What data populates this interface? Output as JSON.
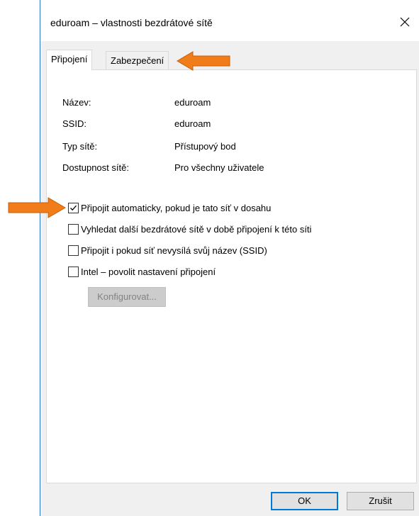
{
  "window": {
    "title": "eduroam – vlastnosti bezdrátové sítě"
  },
  "tabs": [
    {
      "label": "Připojení"
    },
    {
      "label": "Zabezpečení"
    }
  ],
  "properties": [
    {
      "label": "Název:",
      "value": "eduroam"
    },
    {
      "label": "SSID:",
      "value": "eduroam"
    },
    {
      "label": "Typ sítě:",
      "value": "Přístupový bod"
    },
    {
      "label": "Dostupnost sítě:",
      "value": "Pro všechny uživatele"
    }
  ],
  "options": [
    {
      "label": "Připojit automaticky, pokud je tato síť v dosahu",
      "checked": true
    },
    {
      "label": "Vyhledat další bezdrátové sítě v době připojení k této síti",
      "checked": false
    },
    {
      "label": "Připojit i pokud síť nevysílá svůj název (SSID)",
      "checked": false
    },
    {
      "label": "Intel – povolit nastavení připojení",
      "checked": false
    }
  ],
  "buttons": {
    "configure": "Konfigurovat...",
    "ok": "OK",
    "cancel": "Zrušit"
  },
  "colors": {
    "annotation_arrow": "#f07d1a",
    "window_border": "#2a78c7",
    "default_button_border": "#0078d7"
  },
  "icons": {
    "close": "close-icon",
    "check": "checkmark-icon",
    "annotation": "arrow-annotation-icon"
  }
}
